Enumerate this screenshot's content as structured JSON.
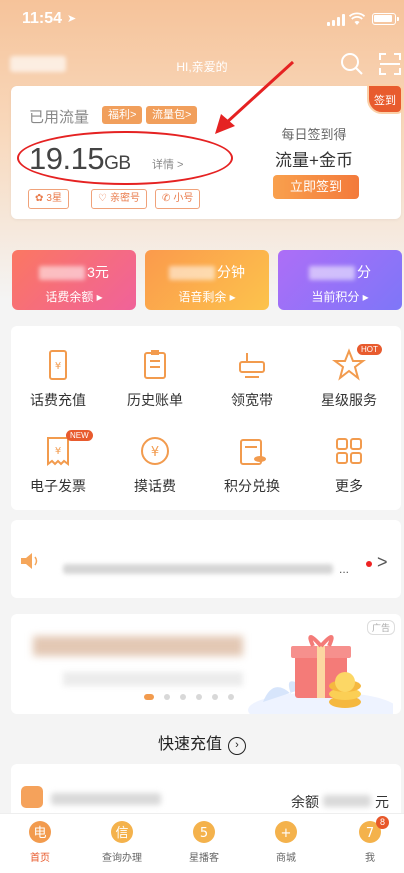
{
  "status_bar": {
    "time": "11:54",
    "location_icon": "location-arrow-icon"
  },
  "topnav": {
    "greeting": "HI,亲爱的"
  },
  "data_card": {
    "used_label": "已用流量",
    "tag_welfare": "福利>",
    "tag_package": "流量包>",
    "value": "19.15",
    "unit": "GB",
    "detail": "详情 >",
    "chips": {
      "star": "3星",
      "family": "亲密号",
      "small": "小号"
    },
    "sign_title": "每日签到得",
    "sign_main": "流量+金币",
    "sign_button": "立即签到",
    "sign_badge": "签到"
  },
  "stats": {
    "balance": {
      "unit": "3元",
      "label": "话费余额 ▸"
    },
    "voice": {
      "unit": "分钟",
      "label": "语音剩余 ▸"
    },
    "points": {
      "unit": "分",
      "label": "当前积分 ▸"
    }
  },
  "services": [
    {
      "label": "话费充值",
      "icon": "phone-recharge-icon"
    },
    {
      "label": "历史账单",
      "icon": "bill-history-icon"
    },
    {
      "label": "领宽带",
      "icon": "broadband-icon"
    },
    {
      "label": "星级服务",
      "icon": "star-service-icon",
      "badge": "HOT"
    },
    {
      "label": "电子发票",
      "icon": "e-invoice-icon",
      "badge": "NEW"
    },
    {
      "label": "摸话费",
      "icon": "coin-icon"
    },
    {
      "label": "积分兑换",
      "icon": "points-exchange-icon"
    },
    {
      "label": "更多",
      "icon": "more-grid-icon"
    }
  ],
  "notice": {
    "dots": "...",
    "chevron": ">"
  },
  "banner": {
    "ad": "广告"
  },
  "quick": {
    "title": "快速充值",
    "balance_label": "余额",
    "yuan": "元"
  },
  "tabbar": [
    {
      "label": "首页",
      "icon": "home-tab-icon",
      "glyph": "电"
    },
    {
      "label": "查询办理",
      "icon": "query-tab-icon",
      "glyph": "信"
    },
    {
      "label": "星播客",
      "icon": "star-podcast-tab-icon",
      "glyph": "5"
    },
    {
      "label": "商城",
      "icon": "mall-tab-icon",
      "glyph": "+"
    },
    {
      "label": "我",
      "icon": "me-tab-icon",
      "glyph": "7",
      "badge": "8"
    }
  ],
  "colors": {
    "accent": "#f29b4e",
    "brand_red": "#e8582a",
    "annotation": "#e52222"
  }
}
